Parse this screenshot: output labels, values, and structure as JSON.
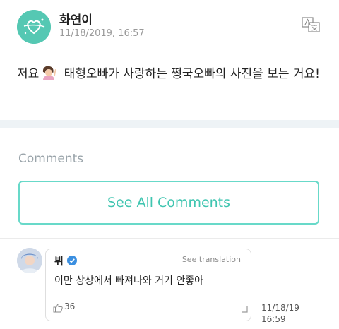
{
  "post": {
    "author": "화연이",
    "date": "11/18/2019, 16:57",
    "text_before_emoji": "저요",
    "text_after_emoji": " 태형오빠가 사랑하는 쩡국오빠의 사진을 보는 거요!",
    "emoji_icon": "person-raising-hand-emoji",
    "translate_icon": "translate-icon"
  },
  "comments": {
    "section_label": "Comments",
    "see_all_label": "See All Comments",
    "items": [
      {
        "author": "뷔",
        "verified": true,
        "see_translation_label": "See translation",
        "text": "이만 상상에서 빠져나와 거기 안좋아",
        "likes": "36",
        "date_line1": "11/18/19",
        "date_line2": "16:59"
      }
    ]
  },
  "colors": {
    "accent": "#3fc5b0",
    "accent_border": "#68d9c9",
    "avatar_bg": "#55c8b3",
    "divider_bg": "#eef3f6",
    "verified_blue": "#3b8fe0"
  }
}
